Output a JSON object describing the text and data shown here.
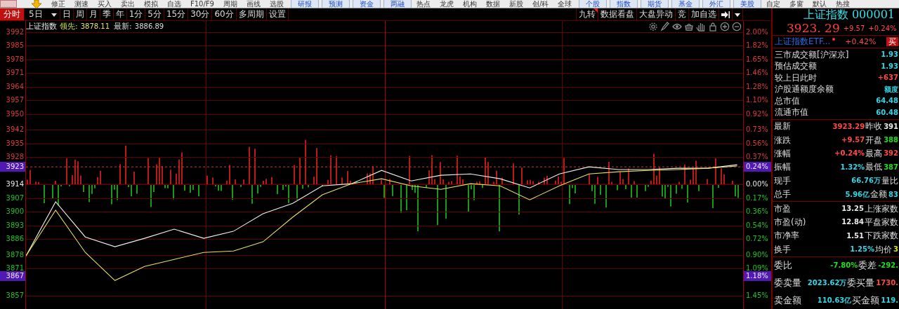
{
  "toolbar": {
    "items": [
      {
        "label": "修正",
        "kind": "text"
      },
      {
        "label": "测速",
        "kind": "text"
      },
      {
        "label": "买入",
        "kind": "text"
      },
      {
        "label": "卖出",
        "kind": "text"
      },
      {
        "label": "模拟",
        "kind": "text"
      },
      {
        "label": "自选",
        "kind": "text"
      },
      {
        "label": "F10/F9",
        "kind": "text"
      },
      {
        "label": "周期",
        "kind": "text"
      },
      {
        "label": "画线",
        "kind": "text"
      },
      {
        "label": "选股",
        "kind": "text"
      },
      {
        "label": "研报",
        "kind": "boxed"
      },
      {
        "label": "预测",
        "kind": "boxed"
      },
      {
        "label": "资金",
        "kind": "boxed"
      },
      {
        "label": "两融",
        "kind": "boxed"
      },
      {
        "label": "热点",
        "kind": "text"
      },
      {
        "label": "龙虎",
        "kind": "text"
      },
      {
        "label": "机构",
        "kind": "text"
      },
      {
        "label": "数据",
        "kind": "text"
      },
      {
        "label": "新股",
        "kind": "text"
      },
      {
        "label": "创/科",
        "kind": "text"
      },
      {
        "label": "全球",
        "kind": "text"
      },
      {
        "label": "个股",
        "kind": "boxed"
      },
      {
        "label": "指数",
        "kind": "boxed"
      },
      {
        "label": "期货",
        "kind": "boxed"
      },
      {
        "label": "基金",
        "kind": "boxed"
      },
      {
        "label": "外汇",
        "kind": "boxed"
      },
      {
        "label": "美股",
        "kind": "boxed"
      },
      {
        "label": "自定",
        "kind": "text"
      },
      {
        "label": "多窗",
        "kind": "text"
      },
      {
        "label": "默认",
        "kind": "text"
      },
      {
        "label": "热搜",
        "kind": "text"
      }
    ]
  },
  "period_tabs": [
    {
      "label": "分时",
      "selected": true,
      "dropdown": false
    },
    {
      "label": "5日",
      "selected": false,
      "dropdown": true
    },
    {
      "label": "日",
      "selected": false,
      "dropdown": false
    },
    {
      "label": "周",
      "selected": false,
      "dropdown": false
    },
    {
      "label": "月",
      "selected": false,
      "dropdown": false
    },
    {
      "label": "季",
      "selected": false,
      "dropdown": false
    },
    {
      "label": "年",
      "selected": false,
      "dropdown": false
    },
    {
      "label": "1分",
      "selected": false,
      "dropdown": false
    },
    {
      "label": "5分",
      "selected": false,
      "dropdown": false
    },
    {
      "label": "15分",
      "selected": false,
      "dropdown": false
    },
    {
      "label": "30分",
      "selected": false,
      "dropdown": false
    },
    {
      "label": "60分",
      "selected": false,
      "dropdown": false
    },
    {
      "label": "多周期",
      "selected": false,
      "dropdown": false
    },
    {
      "label": "设置",
      "selected": false,
      "dropdown": false
    }
  ],
  "chart_tools": [
    {
      "label": "九转",
      "flagged": true
    },
    {
      "label": "数据看盘",
      "flagged": false
    },
    {
      "label": "大盘异动",
      "flagged": false
    },
    {
      "label": "竞",
      "flagged": false
    },
    {
      "label": "加自选",
      "flagged": false
    }
  ],
  "chart_info": {
    "name": "上证指数",
    "lead_label": "领先:",
    "lead_value": "3878.11",
    "last_label": "最新:",
    "last_value": "3886.89"
  },
  "chart": {
    "chart_data": {
      "type": "line",
      "categories": [
        null,
        null,
        null,
        null,
        null,
        null,
        null,
        null,
        null,
        null,
        null,
        null,
        null,
        null,
        null,
        null,
        null,
        null,
        null,
        null,
        null,
        null,
        null,
        null,
        null
      ],
      "ylim": [
        3850.2,
        3997.7
      ],
      "series": [
        {
          "color": "#f0f0f0",
          "values": [
            3877.4,
            3905.1,
            3887.1,
            3882.1,
            3886.4,
            3891.1,
            3886.4,
            3890.0,
            3899.0,
            3904.3,
            3913.3,
            3914.4,
            3921.2,
            3915.8,
            3918.7,
            3919.4,
            3916.9,
            3912.2,
            3919.4,
            3923.0,
            3921.6,
            3921.6,
            3922.3,
            3922.3,
            3924.1
          ]
        },
        {
          "color": "#e8e060",
          "values": [
            3877.4,
            3900.8,
            3879.2,
            3864.8,
            3872.0,
            3875.6,
            3879.2,
            3879.9,
            3884.6,
            3897.2,
            3908.7,
            3914.4,
            3916.9,
            3913.3,
            3911.5,
            3914.4,
            3913.3,
            3906.1,
            3913.3,
            3919.4,
            3920.5,
            3921.2,
            3921.6,
            3922.3,
            3923.4
          ]
        }
      ],
      "yticks": [
        {
          "value": 3992,
          "label": "3992"
        },
        {
          "value": 3985,
          "label": "3985"
        },
        {
          "value": 3978,
          "label": "3978"
        },
        {
          "value": 3971,
          "label": "3971"
        },
        {
          "value": 3964,
          "label": "3964"
        },
        {
          "value": 3957,
          "label": "3957"
        },
        {
          "value": 3950,
          "label": "3950"
        },
        {
          "value": 3942,
          "label": "3942"
        },
        {
          "value": 3935,
          "label": "3935"
        },
        {
          "value": 3928,
          "label": "3928"
        },
        {
          "value": 3914,
          "label": "3914"
        },
        {
          "value": 3907,
          "label": "3907"
        },
        {
          "value": 3900,
          "label": "3900"
        },
        {
          "value": 3893,
          "label": "3893"
        },
        {
          "value": 3886,
          "label": "3886"
        },
        {
          "value": 3878,
          "label": "3878"
        },
        {
          "value": 3871,
          "label": "3871"
        },
        {
          "value": 3857,
          "label": "3857"
        }
      ],
      "orientation": "vertical",
      "grid": true
    },
    "markers": [
      {
        "kind": "price",
        "label": "3923",
        "percent": "0.24%",
        "level": 0.4936
      },
      {
        "kind": "cursor",
        "label": "3867",
        "percent": "1.18%",
        "level": 0.1139
      }
    ],
    "percent_labels": [
      {
        "label": "2.00%",
        "kind": "up"
      },
      {
        "label": "1.82%",
        "kind": "up"
      },
      {
        "label": "1.65%",
        "kind": "up"
      },
      {
        "label": "1.46%",
        "kind": "up"
      },
      {
        "label": "1.28%",
        "kind": "up"
      },
      {
        "label": "1.10%",
        "kind": "up"
      },
      {
        "label": "0.92%",
        "kind": "up"
      },
      {
        "label": "0.73%",
        "kind": "up"
      },
      {
        "label": "0.56%",
        "kind": "up"
      },
      {
        "label": "0.37%",
        "kind": "up"
      },
      {
        "label": "0.00%",
        "kind": "flat"
      },
      {
        "label": "0.17%",
        "kind": "down"
      },
      {
        "label": "0.36%",
        "kind": "down"
      },
      {
        "label": "0.54%",
        "kind": "down"
      },
      {
        "label": "0.72%",
        "kind": "down"
      },
      {
        "label": "0.90%",
        "kind": "down"
      },
      {
        "label": "1.09%",
        "kind": "down"
      },
      {
        "label": "1.45%",
        "kind": "down"
      }
    ]
  },
  "quote_panel": {
    "title": "上证指数 000001",
    "price": "3923. 29",
    "change": "+9.57",
    "change_pct": "+0.24%",
    "etf": {
      "name": "上证指数ETF...",
      "change": "+0.42%",
      "action": "买"
    },
    "stats": [
      {
        "label": "三市成交额[沪深京]",
        "value": "1.93",
        "color": "#33d6e6"
      },
      {
        "label": "预估成交额",
        "value": "1.93",
        "color": "#33d6e6"
      },
      {
        "label": "较上日此时",
        "value": "+637",
        "color": "#ff4a4a"
      },
      {
        "label": "沪股通额度余额",
        "value": "额度",
        "color": "#33d6e6"
      },
      {
        "label": "总市值",
        "value": "64.48",
        "color": "#33d6e6"
      },
      {
        "label": "流通市值",
        "value": "60.48",
        "color": "#33d6e6"
      }
    ],
    "sections": [
      [
        [
          {
            "label": "最新",
            "value": "3923.29",
            "color": "#ff4a4a"
          },
          {
            "label": "昨收",
            "value": "391",
            "color": "#e8e8e8"
          }
        ],
        [
          {
            "label": "涨跌",
            "value": "+9.57",
            "color": "#ff4a4a"
          },
          {
            "label": "开盘",
            "value": "388",
            "color": "#22dd22"
          }
        ],
        [
          {
            "label": "涨幅",
            "value": "+0.24%",
            "color": "#ff4a4a"
          },
          {
            "label": "最高",
            "value": "392",
            "color": "#ff4a4a"
          }
        ],
        [
          {
            "label": "振幅",
            "value": "1.32%",
            "color": "#33d6e6"
          },
          {
            "label": "最低",
            "value": "387",
            "color": "#22dd22"
          }
        ],
        [
          {
            "label": "现手",
            "value": "66.76万",
            "color": "#33d6e6"
          },
          {
            "label": "量比"
          }
        ],
        [
          {
            "label": "总手",
            "value": "5.96亿",
            "color": "#33d6e6"
          },
          {
            "label": "金额",
            "value": "83",
            "color": "#33d6e6"
          }
        ]
      ],
      [
        [
          {
            "label": "市盈",
            "value": "13.25",
            "color": "#e8e8e8"
          },
          {
            "label": "上涨家数"
          }
        ],
        [
          {
            "label": "市盈(动)",
            "value": "12.84",
            "color": "#e8e8e8"
          },
          {
            "label": "平盘家数"
          }
        ],
        [
          {
            "label": "市净率",
            "value": "1.51",
            "color": "#e8e8e8"
          },
          {
            "label": "下跌家数"
          }
        ],
        [
          {
            "label": "换手",
            "value": "1.25%",
            "color": "#33d6e6"
          },
          {
            "label": "均价",
            "value": "3",
            "color": "#e0e000"
          }
        ]
      ],
      [
        [
          {
            "label": "委比",
            "value": "-7.80%",
            "color": "#22dd22"
          },
          {
            "label": "委差",
            "value": "-292.",
            "color": "#22dd22"
          }
        ],
        [
          {
            "label": "委卖量",
            "value": "2023.62万",
            "color": "#33d6e6"
          },
          {
            "label": "委买量",
            "value": "1730.",
            "color": "#ff4a4a"
          }
        ],
        [
          {
            "label": "卖金额",
            "value": "110.63亿",
            "color": "#33d6e6"
          },
          {
            "label": "买金额",
            "value": "119.",
            "color": "#33d6e6"
          }
        ]
      ]
    ]
  }
}
